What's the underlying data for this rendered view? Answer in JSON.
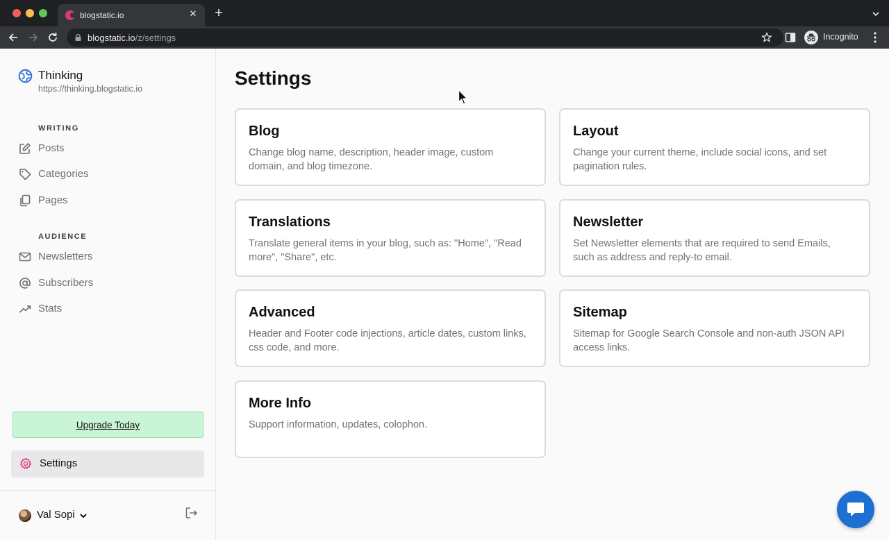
{
  "browser": {
    "tab_title": "blogstatic.io",
    "url_host": "blogstatic.io",
    "url_path": "/z/settings",
    "profile_label": "Incognito"
  },
  "sidebar": {
    "brand_name": "Thinking",
    "brand_url": "https://thinking.blogstatic.io",
    "sections": [
      {
        "label": "WRITING",
        "items": [
          {
            "label": "Posts",
            "icon": "edit-icon"
          },
          {
            "label": "Categories",
            "icon": "tag-icon"
          },
          {
            "label": "Pages",
            "icon": "pages-icon"
          }
        ]
      },
      {
        "label": "AUDIENCE",
        "items": [
          {
            "label": "Newsletters",
            "icon": "mail-icon"
          },
          {
            "label": "Subscribers",
            "icon": "at-icon"
          },
          {
            "label": "Stats",
            "icon": "trending-icon"
          }
        ]
      }
    ],
    "upgrade_label": "Upgrade Today",
    "settings_label": "Settings",
    "user_name": "Val Sopi"
  },
  "main": {
    "title": "Settings",
    "cards": [
      {
        "title": "Blog",
        "desc": "Change blog name, description, header image, custom domain, and blog timezone."
      },
      {
        "title": "Layout",
        "desc": "Change your current theme, include social icons, and set pagination rules."
      },
      {
        "title": "Translations",
        "desc": "Translate general items in your blog, such as: \"Home\", \"Read more\", \"Share\", etc."
      },
      {
        "title": "Newsletter",
        "desc": "Set Newsletter elements that are required to send Emails, such as address and reply-to email."
      },
      {
        "title": "Advanced",
        "desc": "Header and Footer code injections, article dates, custom links, css code, and more."
      },
      {
        "title": "Sitemap",
        "desc": "Sitemap for Google Search Console and non-auth JSON API access links."
      },
      {
        "title": "More Info",
        "desc": "Support information, updates, colophon."
      }
    ]
  },
  "colors": {
    "accent": "#e0397a",
    "upgrade_bg": "#c9f5d6",
    "chat_button": "#1d6fd1"
  }
}
